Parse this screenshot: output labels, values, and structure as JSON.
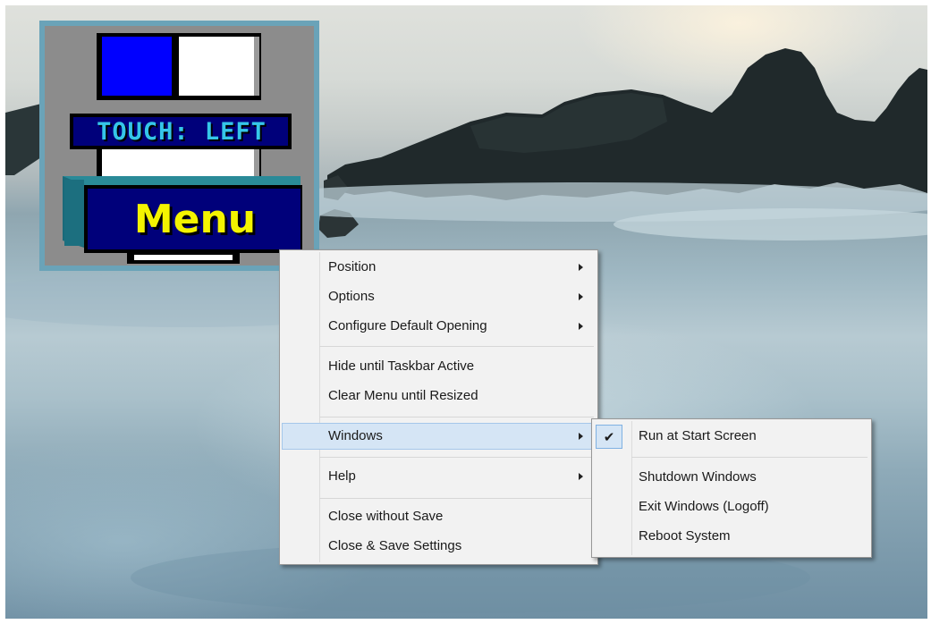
{
  "widget": {
    "touch_label": "TOUCH: LEFT",
    "menu_label": "Menu"
  },
  "main_menu": {
    "items": [
      {
        "label": "Position",
        "has_submenu": true
      },
      {
        "label": "Options",
        "has_submenu": true
      },
      {
        "label": "Configure Default Opening",
        "has_submenu": true
      },
      {
        "label": "Hide until Taskbar Active",
        "has_submenu": false
      },
      {
        "label": "Clear Menu until Resized",
        "has_submenu": false
      },
      {
        "label": "Windows",
        "has_submenu": true,
        "highlighted": true
      },
      {
        "label": "Help",
        "has_submenu": true
      },
      {
        "label": "Close without Save",
        "has_submenu": false
      },
      {
        "label": "Close & Save Settings",
        "has_submenu": false
      }
    ]
  },
  "windows_submenu": {
    "items": [
      {
        "label": "Run at Start Screen",
        "checked": true,
        "check_glyph": "✔"
      },
      {
        "label": "Shutdown Windows",
        "checked": false
      },
      {
        "label": "Exit Windows (Logoff)",
        "checked": false
      },
      {
        "label": "Reboot System",
        "checked": false
      }
    ]
  },
  "colors": {
    "menu_background": "#f2f2f2",
    "highlight": "#d5e5f5",
    "highlight_border": "#a5c7ea",
    "widget_frame": "#6aa3b8",
    "floppy_blue": "#0000ff",
    "floppy_navy": "#00007a",
    "label_yellow": "#f4f400",
    "label_cyan": "#35c6e8"
  }
}
